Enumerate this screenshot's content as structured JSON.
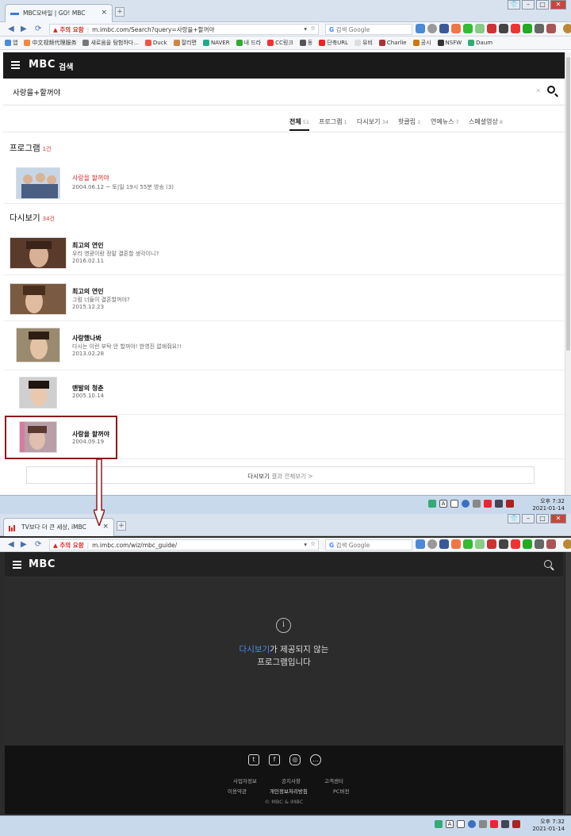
{
  "window1": {
    "tab_title": "MBC모바일 | GO! MBC",
    "address": {
      "warning": "▲ 주의 요함",
      "url": "m.imbc.com/Search?query=사랑을+할꺼야"
    },
    "google_search_placeholder": "검색 Google",
    "bookmarks": [
      "앱",
      "中文视频代理服务",
      "새로움을 탐험하다...",
      "Duck",
      "잘리면",
      "NAVER",
      "내 드라",
      "CC링크",
      "동",
      "단축URL",
      "유비",
      "Charlie",
      "공시",
      "NSFW",
      "Daum"
    ],
    "header": {
      "logo": "MBC",
      "logo_suffix": "검색"
    },
    "search": {
      "query": "사랑을+할꺼야",
      "clear": "✕"
    },
    "tabs": [
      {
        "label": "전체",
        "count": "51"
      },
      {
        "label": "프로그램",
        "count": "1"
      },
      {
        "label": "다시보기",
        "count": "34"
      },
      {
        "label": "핫클립",
        "count": "1"
      },
      {
        "label": "연예뉴스",
        "count": "7"
      },
      {
        "label": "스페셜영상",
        "count": "8"
      }
    ],
    "program_section": {
      "title": "프로그램",
      "count": "1건"
    },
    "program_item": {
      "title": "사랑을 할꺼야",
      "sub": "2004.06.12 ~ 토|일 19시 55분 방송 (3)"
    },
    "replay_section": {
      "title": "다시보기",
      "count": "34건"
    },
    "replays": [
      {
        "title": "최고의 연인",
        "desc": "우리 영광이랑 정말 결혼할 생각이니?",
        "date": "2016.02.11"
      },
      {
        "title": "최고의 연인",
        "desc": "그럼 너들이 결혼할꺼야?",
        "date": "2015.12.23"
      },
      {
        "title": "사랑했나봐",
        "desc": "다시는 이런 부탁 안 할꺼야! 한영진 없애줘요!!",
        "date": "2013.02.28"
      },
      {
        "title": "맨발의 청춘",
        "desc": "",
        "date": "2005.10.14"
      },
      {
        "title": "사랑을 할꺼야",
        "desc": "",
        "date": "2004.09.19"
      }
    ],
    "more_button": {
      "bold": "다시보기",
      "rest": "결과 전체보기 >"
    },
    "clock": {
      "time": "오후 7:32",
      "date": "2021-01-14"
    }
  },
  "window2": {
    "tab_title": "TV보다 더 큰 세상, iMBC",
    "address": {
      "warning": "▲ 주의 요함",
      "url": "m.imbc.com/wiz/mbc_guide/"
    },
    "google_search_placeholder": "검색 Google",
    "header": {
      "logo": "MBC"
    },
    "message": {
      "highlight": "다시보기",
      "line1_rest": "가 제공되지 않는",
      "line2": "프로그램입니다"
    },
    "footer": {
      "social": [
        "twitter",
        "facebook",
        "instagram",
        "line"
      ],
      "links_row1": [
        "사업자정보",
        "공지사항",
        "고객센터"
      ],
      "links_row2": [
        "이용약관",
        "개인정보처리방침",
        "PC버전"
      ],
      "copyright": "© MBC & iMBC"
    },
    "clock": {
      "time": "오후 7:32",
      "date": "2021-01-14"
    }
  },
  "colors": {
    "mbc_header": "#1a1a1a",
    "accent_red": "#d02b2b",
    "highlight_box": "#8b1a1a",
    "link_blue": "#3f8ff5"
  }
}
